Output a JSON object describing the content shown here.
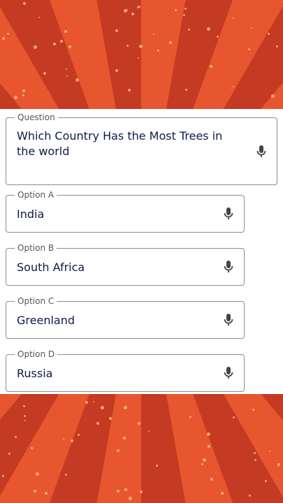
{
  "question": {
    "label": "Question",
    "value": "Which Country Has the Most Trees in the world",
    "icon": "mic-icon"
  },
  "options": [
    {
      "label": "Option A",
      "value": "India",
      "icon": "mic-icon"
    },
    {
      "label": "Option B",
      "value": "South Africa",
      "icon": "mic-icon"
    },
    {
      "label": "Option C",
      "value": "Greenland",
      "icon": "mic-icon"
    },
    {
      "label": "Option D",
      "value": "Russia",
      "icon": "mic-icon"
    }
  ],
  "colors": {
    "background_ray_light": "#e7562e",
    "background_ray_dark": "#c53a22",
    "text": "#0d1b4a"
  }
}
